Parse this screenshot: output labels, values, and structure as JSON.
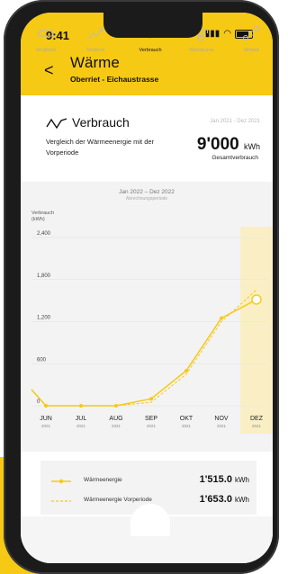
{
  "status_bar": {
    "time": "9:41"
  },
  "header": {
    "title": "Wärme",
    "subtitle": "Oberriet - Eichaustrasse",
    "back_label": "<"
  },
  "summary": {
    "title": "Verbrauch",
    "date_range": "Jan 2021 - Dez 2021",
    "description": "Vergleich der Wärmeenergie mit der Vorperiode",
    "total_value": "9'000",
    "total_unit": "kWh",
    "total_label": "Gesamtverbrauch"
  },
  "chart_header": {
    "period": "Jan 2022 – Dez 2022",
    "period_sub": "Abrechnungsperiode"
  },
  "chart_data": {
    "type": "line",
    "ylabel_line1": "Verbrauch",
    "ylabel_line2": "(kWh)",
    "ylim": [
      0,
      2400
    ],
    "yticks": [
      0,
      600,
      1200,
      1800,
      2400
    ],
    "x_labels": [
      {
        "m": "JUN",
        "y": "2021"
      },
      {
        "m": "JUL",
        "y": "2021"
      },
      {
        "m": "AUG",
        "y": "2021"
      },
      {
        "m": "SEP",
        "y": "2021"
      },
      {
        "m": "OKT",
        "y": "2021"
      },
      {
        "m": "NOV",
        "y": "2021"
      },
      {
        "m": "DEZ",
        "y": "2021"
      }
    ],
    "series": [
      {
        "name": "Wärmeenergie",
        "style": "solid",
        "values": [
          0,
          0,
          0,
          100,
          500,
          1250,
          1515
        ]
      },
      {
        "name": "Wärmeenergie Vorperiode",
        "style": "dashed",
        "values": [
          0,
          0,
          0,
          50,
          450,
          1200,
          1653
        ]
      }
    ],
    "highlight": "DEZ",
    "colors": {
      "line": "#f6c915",
      "highlight": "#faefc4"
    }
  },
  "legend": {
    "items": [
      {
        "label": "Wärmeenergie",
        "value": "1'515.0",
        "unit": "kWh"
      },
      {
        "label": "Wärmeenergie Vorperiode",
        "value": "1'653.0",
        "unit": "kWh"
      }
    ]
  },
  "tabs": [
    {
      "label": "Vergleich",
      "icon": "compare-icon"
    },
    {
      "label": "Tendenz",
      "icon": "trend-icon"
    },
    {
      "label": "Verbrauch",
      "icon": "consumption-icon",
      "active": true
    },
    {
      "label": "Klimakurve",
      "icon": "climate-icon"
    },
    {
      "label": "Verlauf",
      "icon": "history-icon"
    }
  ]
}
